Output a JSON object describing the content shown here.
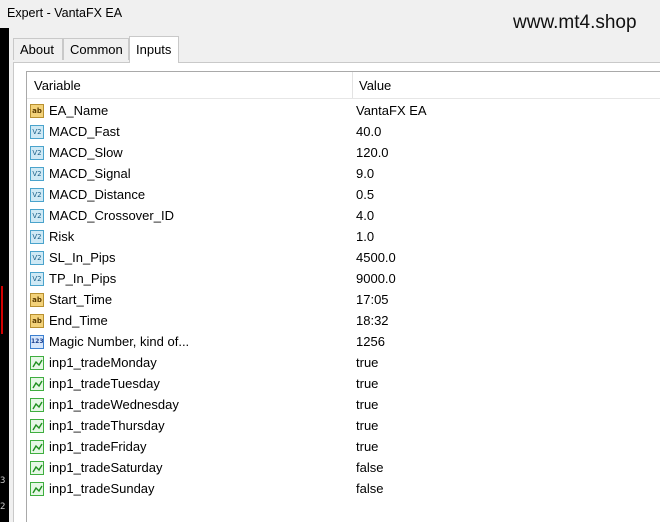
{
  "window": {
    "title": "Expert - VantaFX EA"
  },
  "watermark": "www.mt4.shop",
  "side_digits": [
    "3",
    "2"
  ],
  "tabs": [
    {
      "label": "About",
      "active": false
    },
    {
      "label": "Common",
      "active": false
    },
    {
      "label": "Inputs",
      "active": true
    }
  ],
  "grid": {
    "col_variable": "Variable",
    "col_value": "Value",
    "rows": [
      {
        "icon": "ab",
        "name": "EA_Name",
        "value": "VantaFX EA"
      },
      {
        "icon": "v2",
        "name": "MACD_Fast",
        "value": "40.0"
      },
      {
        "icon": "v2",
        "name": "MACD_Slow",
        "value": "120.0"
      },
      {
        "icon": "v2",
        "name": "MACD_Signal",
        "value": "9.0"
      },
      {
        "icon": "v2",
        "name": "MACD_Distance",
        "value": "0.5"
      },
      {
        "icon": "v2",
        "name": "MACD_Crossover_ID",
        "value": "4.0"
      },
      {
        "icon": "v2",
        "name": "Risk",
        "value": "1.0"
      },
      {
        "icon": "v2",
        "name": "SL_In_Pips",
        "value": "4500.0"
      },
      {
        "icon": "v2",
        "name": "TP_In_Pips",
        "value": "9000.0"
      },
      {
        "icon": "ab",
        "name": "Start_Time",
        "value": "17:05"
      },
      {
        "icon": "ab",
        "name": "End_Time",
        "value": "18:32"
      },
      {
        "icon": "123",
        "name": "Magic Number, kind of...",
        "value": "1256"
      },
      {
        "icon": "bool",
        "name": "inp1_tradeMonday",
        "value": "true"
      },
      {
        "icon": "bool",
        "name": "inp1_tradeTuesday",
        "value": "true"
      },
      {
        "icon": "bool",
        "name": "inp1_tradeWednesday",
        "value": "true"
      },
      {
        "icon": "bool",
        "name": "inp1_tradeThursday",
        "value": "true"
      },
      {
        "icon": "bool",
        "name": "inp1_tradeFriday",
        "value": "true"
      },
      {
        "icon": "bool",
        "name": "inp1_tradeSaturday",
        "value": "false"
      },
      {
        "icon": "bool",
        "name": "inp1_tradeSunday",
        "value": "false"
      }
    ]
  }
}
